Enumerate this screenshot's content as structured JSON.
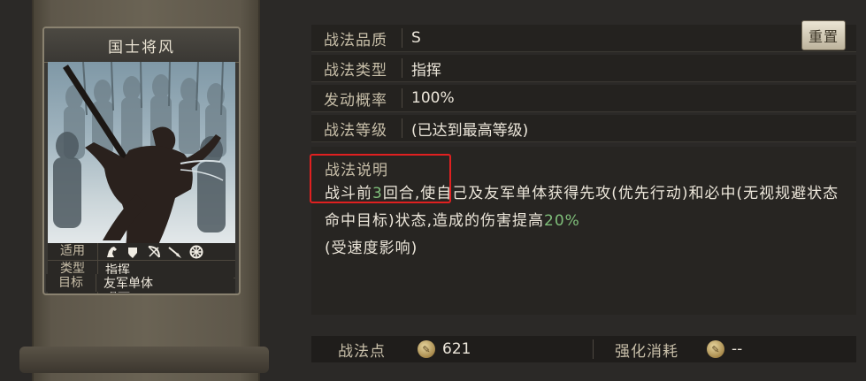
{
  "card": {
    "title": "国士将风",
    "props": [
      {
        "key": "适用",
        "icons": [
          "cavalry-icon",
          "shield-icon",
          "bow-icon",
          "spear-icon",
          "wheel-icon"
        ]
      },
      {
        "key": "类型",
        "value": "指挥"
      },
      {
        "key": "效果",
        "value": "增益"
      },
      {
        "key": "目标",
        "value": "友军单体"
      }
    ]
  },
  "info_rows": [
    {
      "label": "战法品质",
      "value": "S"
    },
    {
      "label": "战法类型",
      "value": "指挥"
    },
    {
      "label": "发动概率",
      "value": "100%"
    },
    {
      "label": "战法等级",
      "value": "(已达到最高等级)"
    }
  ],
  "reset_label": "重置",
  "description": {
    "title": "战法说明",
    "text_part1": "战斗前",
    "highlight1": "3",
    "text_part2": "回合,使自己及友军单体获得先攻(优先行动)和必中(无视规避状态命中目标)状态,造成的伤害提高",
    "highlight2": "20%",
    "text_part3": "(受速度影响)"
  },
  "bottom": {
    "points_label": "战法点",
    "points_value": "621",
    "cost_label": "强化消耗",
    "cost_value": "--"
  },
  "colors": {
    "highlight": "#7fbf7a",
    "annotation": "#e02020"
  }
}
